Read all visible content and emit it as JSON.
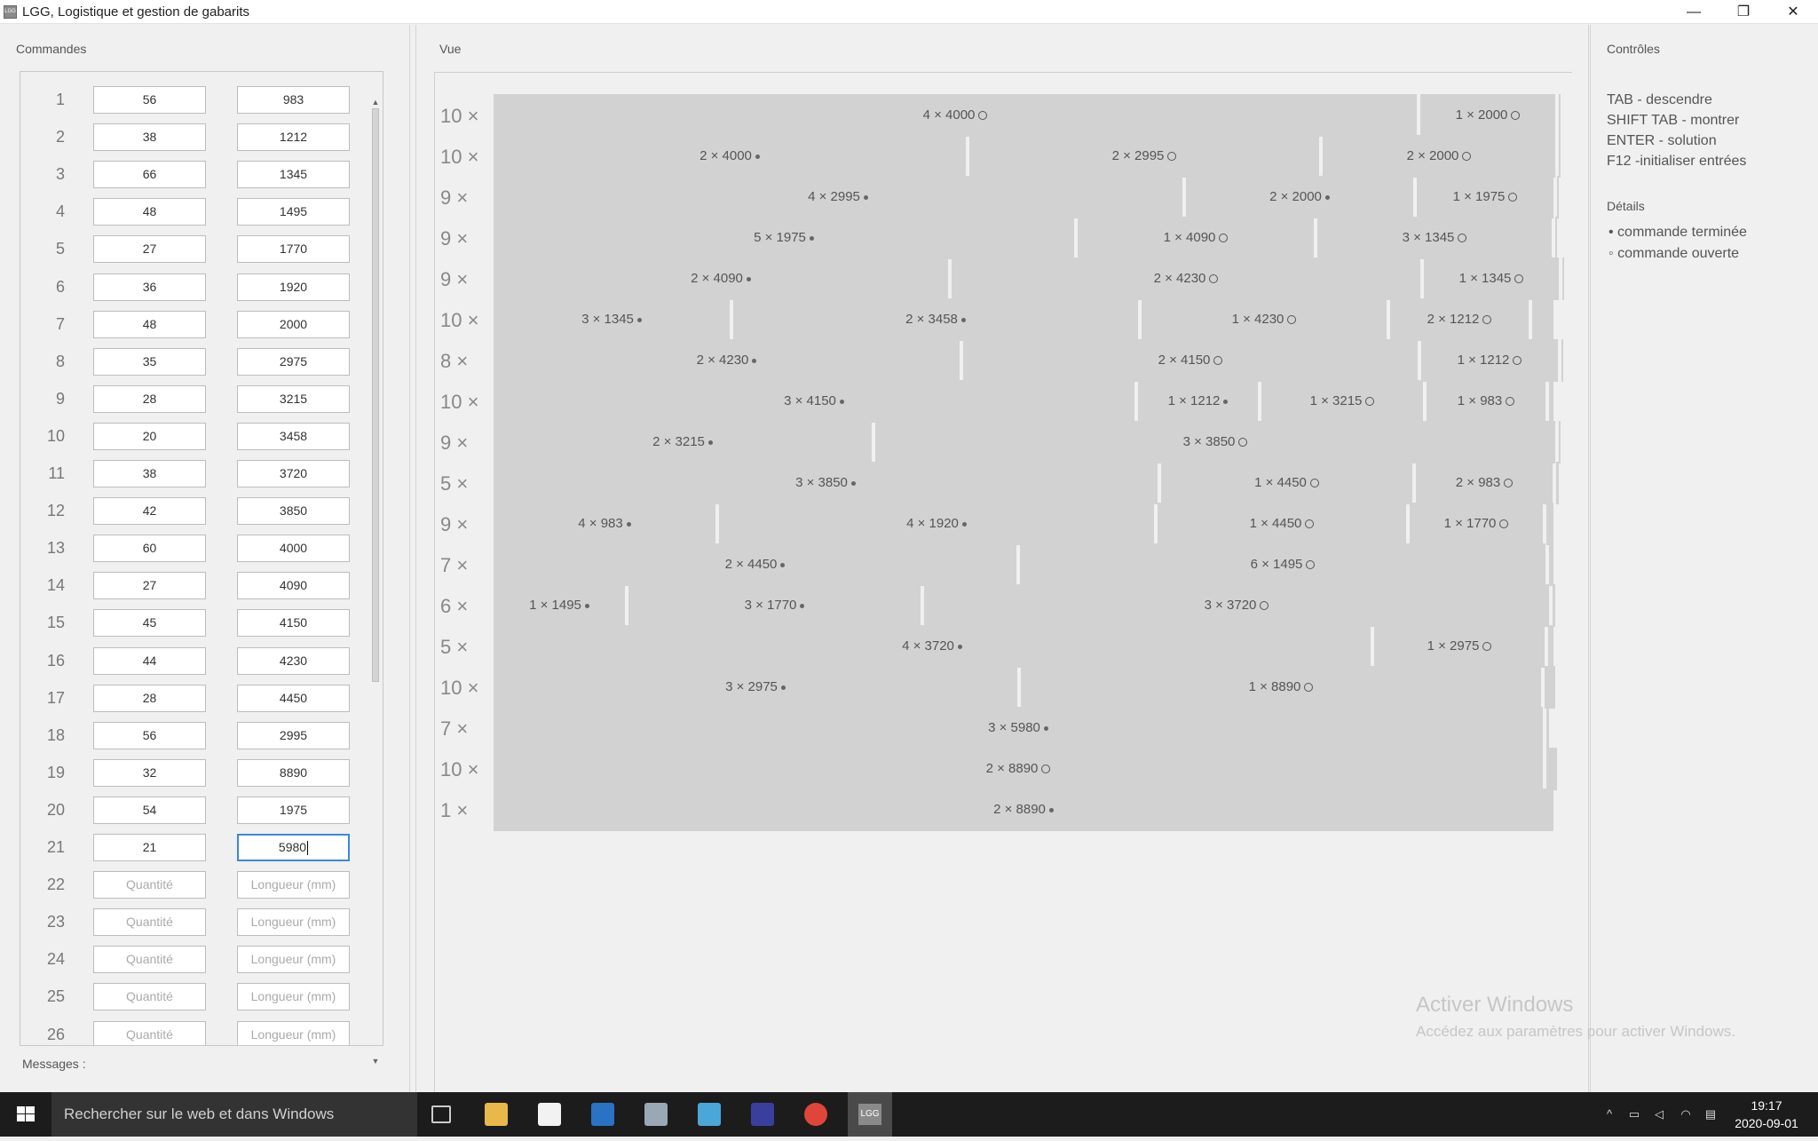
{
  "window": {
    "title": "LGG, Logistique et gestion de gabarits",
    "icon_text": "LGG",
    "min_glyph": "—",
    "max_glyph": "❐",
    "close_glyph": "✕"
  },
  "orders_panel": {
    "title": "Commandes",
    "placeholder_qty": "Quantité",
    "placeholder_len": "Longueur (mm)",
    "rows": [
      {
        "n": "1",
        "qty": "56",
        "len": "983"
      },
      {
        "n": "2",
        "qty": "38",
        "len": "1212"
      },
      {
        "n": "3",
        "qty": "66",
        "len": "1345"
      },
      {
        "n": "4",
        "qty": "48",
        "len": "1495"
      },
      {
        "n": "5",
        "qty": "27",
        "len": "1770"
      },
      {
        "n": "6",
        "qty": "36",
        "len": "1920"
      },
      {
        "n": "7",
        "qty": "48",
        "len": "2000"
      },
      {
        "n": "8",
        "qty": "35",
        "len": "2975"
      },
      {
        "n": "9",
        "qty": "28",
        "len": "3215"
      },
      {
        "n": "10",
        "qty": "20",
        "len": "3458"
      },
      {
        "n": "11",
        "qty": "38",
        "len": "3720"
      },
      {
        "n": "12",
        "qty": "42",
        "len": "3850"
      },
      {
        "n": "13",
        "qty": "60",
        "len": "4000"
      },
      {
        "n": "14",
        "qty": "27",
        "len": "4090"
      },
      {
        "n": "15",
        "qty": "45",
        "len": "4150"
      },
      {
        "n": "16",
        "qty": "44",
        "len": "4230"
      },
      {
        "n": "17",
        "qty": "28",
        "len": "4450"
      },
      {
        "n": "18",
        "qty": "56",
        "len": "2995"
      },
      {
        "n": "19",
        "qty": "32",
        "len": "8890"
      },
      {
        "n": "20",
        "qty": "54",
        "len": "1975"
      },
      {
        "n": "21",
        "qty": "21",
        "len": "5980",
        "focused": true
      },
      {
        "n": "22",
        "qty": "",
        "len": ""
      },
      {
        "n": "23",
        "qty": "",
        "len": ""
      },
      {
        "n": "24",
        "qty": "",
        "len": ""
      },
      {
        "n": "25",
        "qty": "",
        "len": ""
      },
      {
        "n": "26",
        "qty": "",
        "len": ""
      }
    ],
    "messages_label": "Messages :"
  },
  "view_panel": {
    "title": "Vue",
    "rows": [
      {
        "mult": "10 ×",
        "segments": [
          {
            "label": "4 × 4000",
            "status": "open",
            "w": 1040
          },
          {
            "label": "1 × 2000",
            "status": "open",
            "w": 152
          },
          {
            "label": "",
            "status": "none",
            "w": 2
          }
        ]
      },
      {
        "mult": "10 ×",
        "segments": [
          {
            "label": "2 × 4000",
            "status": "done",
            "w": 532
          },
          {
            "label": "2 × 2995",
            "status": "open",
            "w": 394
          },
          {
            "label": "2 × 2000",
            "status": "open",
            "w": 262
          },
          {
            "label": "",
            "status": "none",
            "w": 2
          }
        ]
      },
      {
        "mult": "9 ×",
        "segments": [
          {
            "label": "4 × 2995",
            "status": "done",
            "w": 776
          },
          {
            "label": "2 × 2000",
            "status": "done",
            "w": 256
          },
          {
            "label": "1 × 1975",
            "status": "open",
            "w": 154
          },
          {
            "label": "",
            "status": "none",
            "w": 2
          }
        ]
      },
      {
        "mult": "9 ×",
        "segments": [
          {
            "label": "5 × 1975",
            "status": "done",
            "w": 654
          },
          {
            "label": "1 × 4090",
            "status": "open",
            "w": 266
          },
          {
            "label": "3 × 1345",
            "status": "open",
            "w": 264
          },
          {
            "label": "",
            "status": "none",
            "w": 2
          }
        ]
      },
      {
        "mult": "9 ×",
        "segments": [
          {
            "label": "2 × 4090",
            "status": "done",
            "w": 512
          },
          {
            "label": "2 × 4230",
            "status": "open",
            "w": 528
          },
          {
            "label": "1 × 1345",
            "status": "open",
            "w": 152
          },
          {
            "label": "",
            "status": "none",
            "w": 2
          }
        ]
      },
      {
        "mult": "10 ×",
        "segments": [
          {
            "label": "3 × 1345",
            "status": "done",
            "w": 266
          },
          {
            "label": "2 × 3458",
            "status": "done",
            "w": 456
          },
          {
            "label": "1 × 4230",
            "status": "open",
            "w": 276
          },
          {
            "label": "2 × 1212",
            "status": "open",
            "w": 156
          },
          {
            "label": "",
            "status": "none",
            "w": 24
          }
        ]
      },
      {
        "mult": "8 ×",
        "segments": [
          {
            "label": "2 × 4230",
            "status": "done",
            "w": 525
          },
          {
            "label": "2 × 4150",
            "status": "open",
            "w": 512
          },
          {
            "label": "1 × 1212",
            "status": "open",
            "w": 154
          },
          {
            "label": "",
            "status": "none",
            "w": 2
          }
        ]
      },
      {
        "mult": "10 ×",
        "segments": [
          {
            "label": "3 × 4150",
            "status": "done",
            "w": 722
          },
          {
            "label": "1 × 1212",
            "status": "done",
            "w": 135
          },
          {
            "label": "1 × 3215",
            "status": "open",
            "w": 182
          },
          {
            "label": "1 × 983",
            "status": "open",
            "w": 134
          },
          {
            "label": "",
            "status": "none",
            "w": 5
          }
        ]
      },
      {
        "mult": "9 ×",
        "segments": [
          {
            "label": "2 × 3215",
            "status": "done",
            "w": 426
          },
          {
            "label": "3 × 3850",
            "status": "open",
            "w": 766
          },
          {
            "label": "",
            "status": "none",
            "w": 2
          }
        ]
      },
      {
        "mult": "5 ×",
        "segments": [
          {
            "label": "3 × 3850",
            "status": "done",
            "w": 748
          },
          {
            "label": "1 × 4450",
            "status": "open",
            "w": 283
          },
          {
            "label": "2 × 983",
            "status": "open",
            "w": 154
          },
          {
            "label": "",
            "status": "none",
            "w": 3
          }
        ]
      },
      {
        "mult": "9 ×",
        "segments": [
          {
            "label": "4 × 983",
            "status": "done",
            "w": 250
          },
          {
            "label": "4 × 1920",
            "status": "done",
            "w": 490
          },
          {
            "label": "1 × 4450",
            "status": "open",
            "w": 280
          },
          {
            "label": "1 × 1770",
            "status": "open",
            "w": 150
          },
          {
            "label": "",
            "status": "none",
            "w": 8
          }
        ]
      },
      {
        "mult": "7 ×",
        "segments": [
          {
            "label": "2 × 4450",
            "status": "done",
            "w": 589
          },
          {
            "label": "6 × 1495",
            "status": "open",
            "w": 592
          },
          {
            "label": "",
            "status": "none",
            "w": 5
          }
        ]
      },
      {
        "mult": "6 ×",
        "segments": [
          {
            "label": "1 × 1495",
            "status": "done",
            "w": 148
          },
          {
            "label": "3 × 1770",
            "status": "done",
            "w": 329
          },
          {
            "label": "3 × 3720",
            "status": "open",
            "w": 704
          },
          {
            "label": "",
            "status": "none",
            "w": 3
          }
        ]
      },
      {
        "mult": "5 ×",
        "segments": [
          {
            "label": "4 × 3720",
            "status": "done",
            "w": 988
          },
          {
            "label": "1 × 2975",
            "status": "open",
            "w": 192
          },
          {
            "label": "",
            "status": "none",
            "w": 6
          }
        ]
      },
      {
        "mult": "10 ×",
        "segments": [
          {
            "label": "3 × 2975",
            "status": "done",
            "w": 590
          },
          {
            "label": "1 × 8890",
            "status": "open",
            "w": 586
          },
          {
            "label": "",
            "status": "none",
            "w": 12
          }
        ]
      },
      {
        "mult": "7 ×",
        "segments": [
          {
            "label": "3 × 5980",
            "status": "done",
            "w": 1182
          },
          {
            "label": "",
            "status": "none",
            "w": 3
          }
        ]
      },
      {
        "mult": "10 ×",
        "segments": [
          {
            "label": "2 × 8890",
            "status": "open",
            "w": 1182
          },
          {
            "label": "",
            "status": "none",
            "w": 12
          }
        ]
      },
      {
        "mult": "1 ×",
        "segments": [
          {
            "label": "2 × 8890",
            "status": "done",
            "w": 1194
          }
        ]
      }
    ]
  },
  "controls_panel": {
    "title": "Contrôles",
    "shortcuts": [
      "TAB - descendre",
      "SHIFT TAB - montrer",
      "ENTER - solution",
      "F12 -initialiser entrées"
    ],
    "details_title": "Détails",
    "legend": [
      "• commande terminée",
      "◦ commande ouverte"
    ]
  },
  "watermark": {
    "title": "Activer Windows",
    "subtitle": "Accédez aux paramètres pour activer Windows."
  },
  "taskbar": {
    "search_placeholder": "Rechercher sur le web et dans Windows",
    "apps": [
      "task-view",
      "file-explorer",
      "store",
      "outlook",
      "tools",
      "app",
      "visual-studio",
      "chrome",
      "lgg"
    ],
    "lgg_label": "LGG",
    "time": "19:17",
    "date": "2020-09-01"
  },
  "colors": {
    "segment": "#d2d2d2",
    "focus_border": "#3b88d8",
    "taskbar": "#1c1c1c"
  }
}
